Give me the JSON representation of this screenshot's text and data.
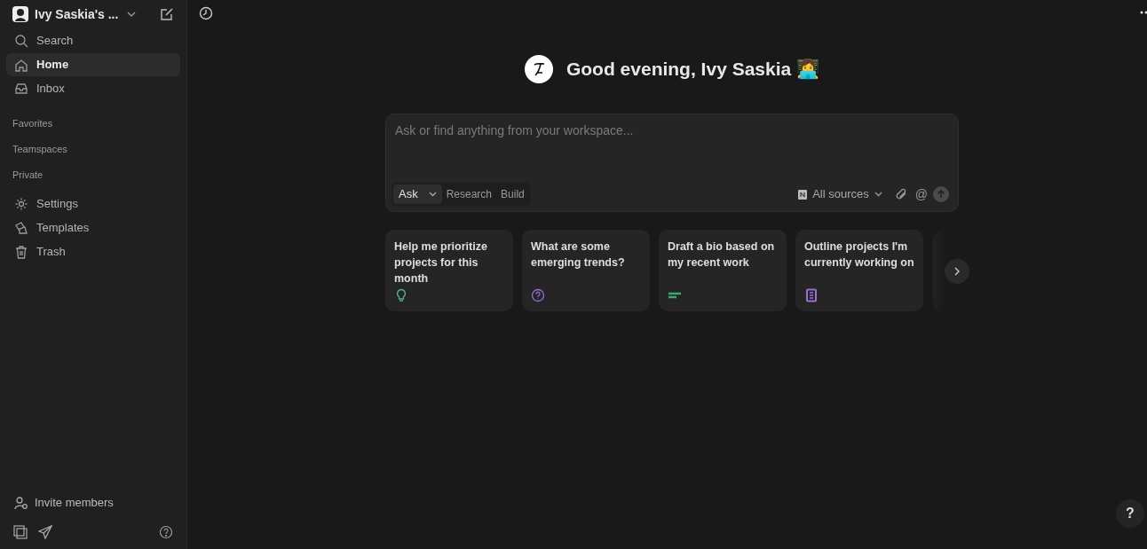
{
  "workspace": {
    "name": "Ivy Saskia's ..."
  },
  "nav": [
    {
      "label": "Search",
      "selected": false
    },
    {
      "label": "Home",
      "selected": true
    },
    {
      "label": "Inbox",
      "selected": false
    }
  ],
  "sections": [
    "Favorites",
    "Teamspaces",
    "Private"
  ],
  "tools": [
    {
      "label": "Settings"
    },
    {
      "label": "Templates"
    },
    {
      "label": "Trash"
    }
  ],
  "invite": "Invite members",
  "greeting": "Good evening, Ivy Saskia 👩‍💻",
  "composer": {
    "placeholder": "Ask or find anything from your workspace...",
    "modes": [
      {
        "label": "Ask",
        "selected": true
      },
      {
        "label": "Research",
        "selected": false
      },
      {
        "label": "Build",
        "selected": false
      }
    ],
    "sources": "All sources",
    "mention": "@"
  },
  "suggestions": [
    {
      "text": "Help me prioritize projects for this month",
      "color": "#4caf7a"
    },
    {
      "text": "What are some emerging trends?",
      "color": "#9a6dd7"
    },
    {
      "text": "Draft a bio based on my recent work",
      "color": "#3aa776"
    },
    {
      "text": "Outline projects I'm currently working on",
      "color": "#9a6dd7"
    }
  ],
  "help": "?"
}
